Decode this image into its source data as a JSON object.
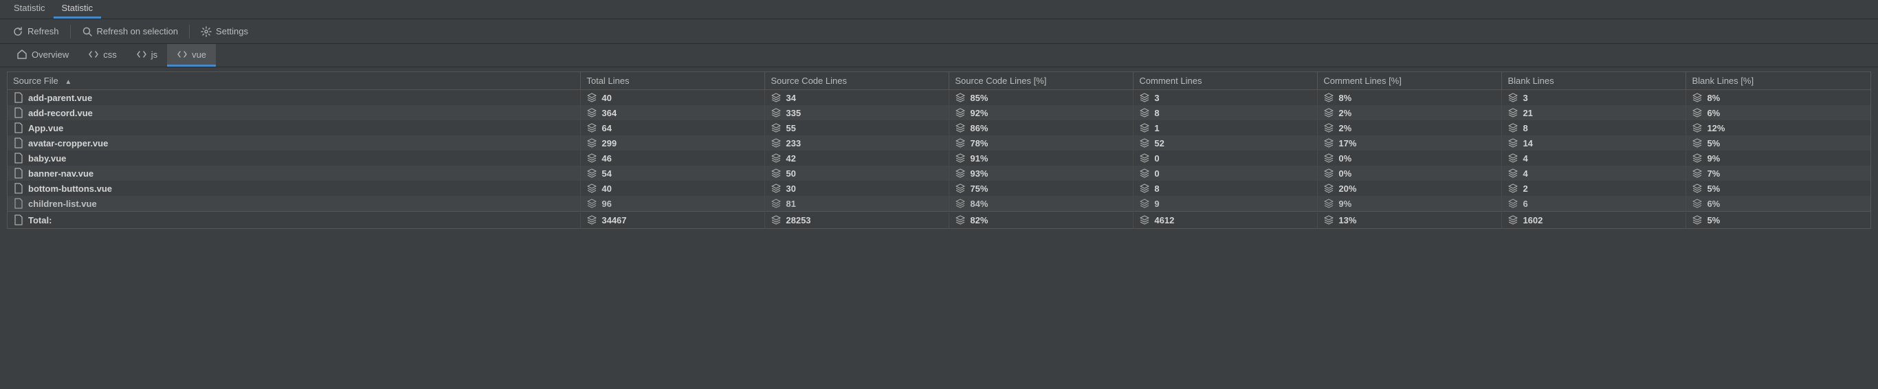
{
  "topTabs": [
    "Statistic",
    "Statistic"
  ],
  "activeTopTab": 1,
  "toolbar": {
    "refresh": "Refresh",
    "refreshOnSelection": "Refresh on selection",
    "settings": "Settings"
  },
  "subTabs": [
    {
      "label": "Overview",
      "icon": "home-icon"
    },
    {
      "label": "css",
      "icon": "code-icon"
    },
    {
      "label": "js",
      "icon": "code-icon"
    },
    {
      "label": "vue",
      "icon": "code-icon"
    }
  ],
  "activeSubTab": 3,
  "columns": [
    "Source File",
    "Total Lines",
    "Source Code Lines",
    "Source Code Lines [%]",
    "Comment Lines",
    "Comment Lines [%]",
    "Blank Lines",
    "Blank Lines [%]"
  ],
  "sortColumn": 0,
  "sortAsc": true,
  "rows": [
    {
      "file": "add-parent.vue",
      "total": "40",
      "code": "34",
      "codePct": "85%",
      "comment": "3",
      "commentPct": "8%",
      "blank": "3",
      "blankPct": "8%"
    },
    {
      "file": "add-record.vue",
      "total": "364",
      "code": "335",
      "codePct": "92%",
      "comment": "8",
      "commentPct": "2%",
      "blank": "21",
      "blankPct": "6%"
    },
    {
      "file": "App.vue",
      "total": "64",
      "code": "55",
      "codePct": "86%",
      "comment": "1",
      "commentPct": "2%",
      "blank": "8",
      "blankPct": "12%"
    },
    {
      "file": "avatar-cropper.vue",
      "total": "299",
      "code": "233",
      "codePct": "78%",
      "comment": "52",
      "commentPct": "17%",
      "blank": "14",
      "blankPct": "5%"
    },
    {
      "file": "baby.vue",
      "total": "46",
      "code": "42",
      "codePct": "91%",
      "comment": "0",
      "commentPct": "0%",
      "blank": "4",
      "blankPct": "9%"
    },
    {
      "file": "banner-nav.vue",
      "total": "54",
      "code": "50",
      "codePct": "93%",
      "comment": "0",
      "commentPct": "0%",
      "blank": "4",
      "blankPct": "7%"
    },
    {
      "file": "bottom-buttons.vue",
      "total": "40",
      "code": "30",
      "codePct": "75%",
      "comment": "8",
      "commentPct": "20%",
      "blank": "2",
      "blankPct": "5%"
    },
    {
      "file": "children-list.vue",
      "total": "96",
      "code": "81",
      "codePct": "84%",
      "comment": "9",
      "commentPct": "9%",
      "blank": "6",
      "blankPct": "6%",
      "partial": true
    }
  ],
  "total": {
    "label": "Total:",
    "total": "34467",
    "code": "28253",
    "codePct": "82%",
    "comment": "4612",
    "commentPct": "13%",
    "blank": "1602",
    "blankPct": "5%"
  }
}
